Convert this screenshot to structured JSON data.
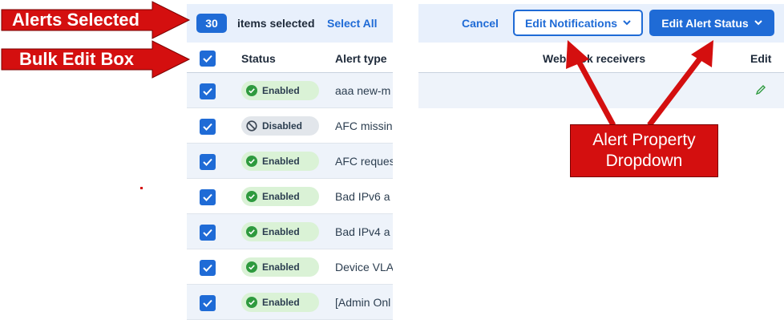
{
  "selection": {
    "count": "30",
    "items_selected_label": "items selected",
    "select_all_label": "Select All"
  },
  "table": {
    "columns": [
      "Status",
      "Alert type"
    ],
    "rows": [
      {
        "status": "Enabled",
        "status_kind": "enabled",
        "type": "aaa new-m",
        "checked": true
      },
      {
        "status": "Disabled",
        "status_kind": "disabled",
        "type": "AFC missin",
        "checked": true
      },
      {
        "status": "Enabled",
        "status_kind": "enabled",
        "type": "AFC reques",
        "checked": true
      },
      {
        "status": "Enabled",
        "status_kind": "enabled",
        "type": "Bad IPv6 a",
        "checked": true
      },
      {
        "status": "Enabled",
        "status_kind": "enabled",
        "type": "Bad IPv4 a",
        "checked": true
      },
      {
        "status": "Enabled",
        "status_kind": "enabled",
        "type": "Device VLA",
        "checked": true
      },
      {
        "status": "Enabled",
        "status_kind": "enabled",
        "type": "[Admin Onl",
        "checked": true
      }
    ]
  },
  "toolbar": {
    "cancel_label": "Cancel",
    "edit_notifications_label": "Edit Notifications",
    "edit_alert_status_label": "Edit Alert Status"
  },
  "right_columns": {
    "webhook_label": "Webhook receivers",
    "edit_label": "Edit"
  },
  "annotations": {
    "alerts_selected": "Alerts Selected",
    "bulk_edit_box": "Bulk Edit Box",
    "alert_property_line1": "Alert Property",
    "alert_property_line2": "Dropdown"
  },
  "colors": {
    "accent": "#1f6bd6",
    "annotation_red": "#d40f0f",
    "enabled_pill": "#daf2d6",
    "disabled_pill": "#e2e6eb"
  }
}
